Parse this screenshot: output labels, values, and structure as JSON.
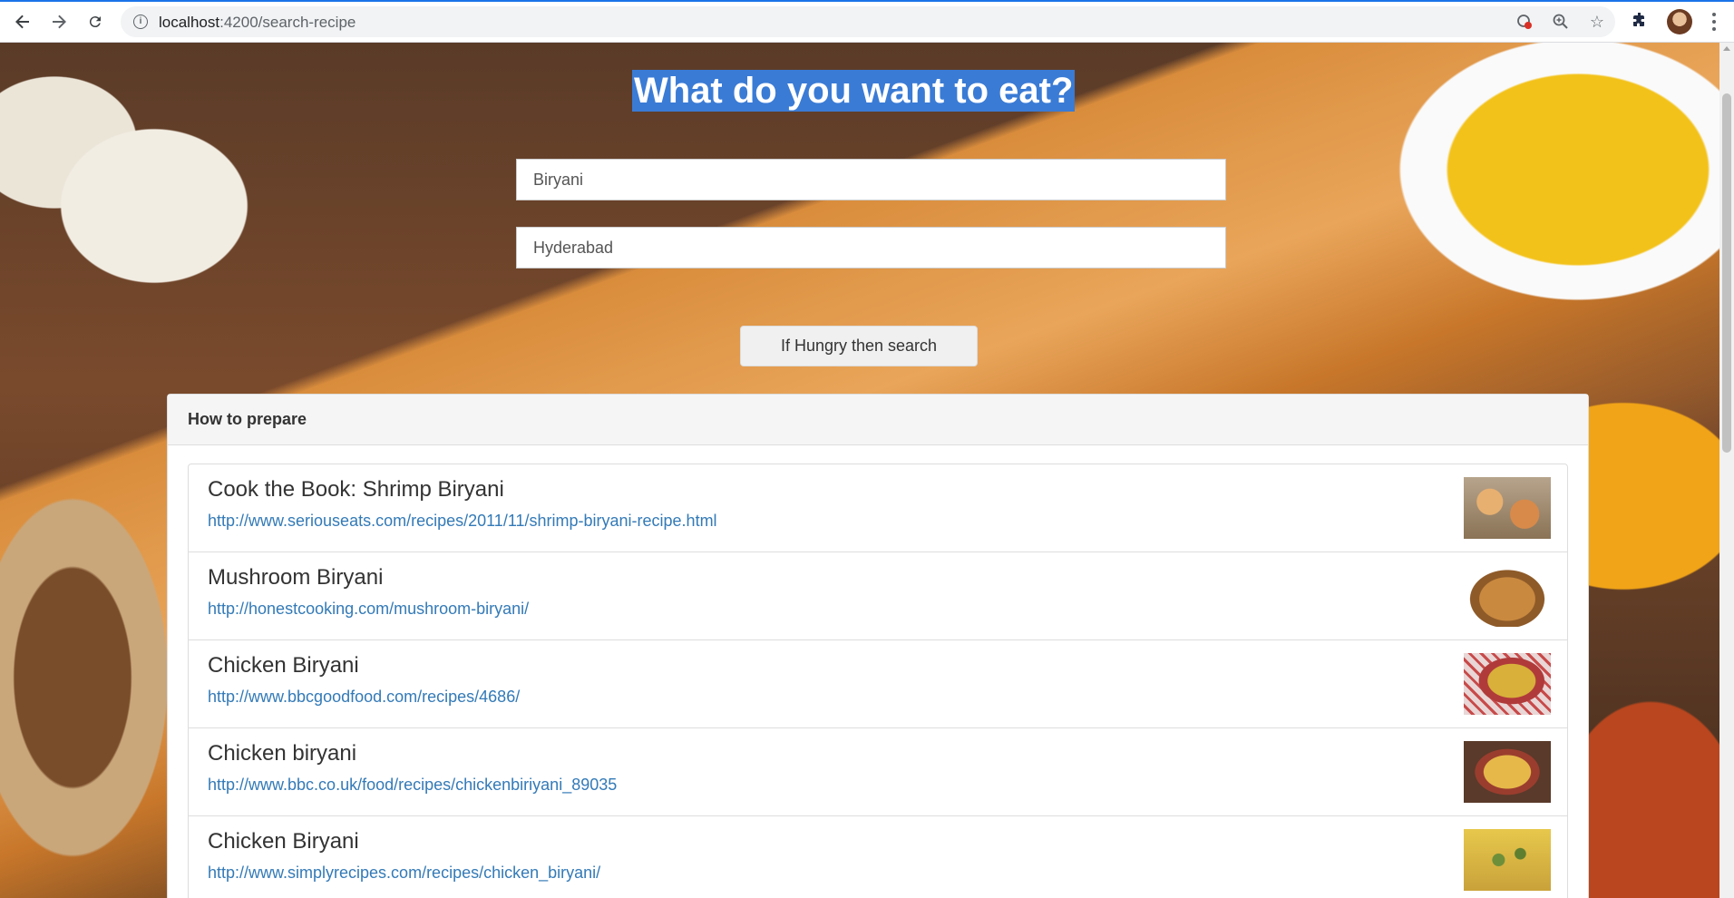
{
  "browser": {
    "url_host": "localhost",
    "url_rest": ":4200/search-recipe"
  },
  "header": {
    "title": "What do you want to eat?"
  },
  "search": {
    "recipe_value": "Biryani",
    "location_value": "Hyderabad",
    "button_label": "If Hungry then search"
  },
  "results": {
    "heading": "How to prepare",
    "items": [
      {
        "title": "Cook the Book: Shrimp Biryani",
        "url": "http://www.seriouseats.com/recipes/2011/11/shrimp-biryani-recipe.html"
      },
      {
        "title": "Mushroom Biryani",
        "url": "http://honestcooking.com/mushroom-biryani/"
      },
      {
        "title": "Chicken Biryani",
        "url": "http://www.bbcgoodfood.com/recipes/4686/"
      },
      {
        "title": "Chicken biryani",
        "url": "http://www.bbc.co.uk/food/recipes/chickenbiriyani_89035"
      },
      {
        "title": "Chicken Biryani",
        "url": "http://www.simplyrecipes.com/recipes/chicken_biryani/"
      }
    ]
  }
}
